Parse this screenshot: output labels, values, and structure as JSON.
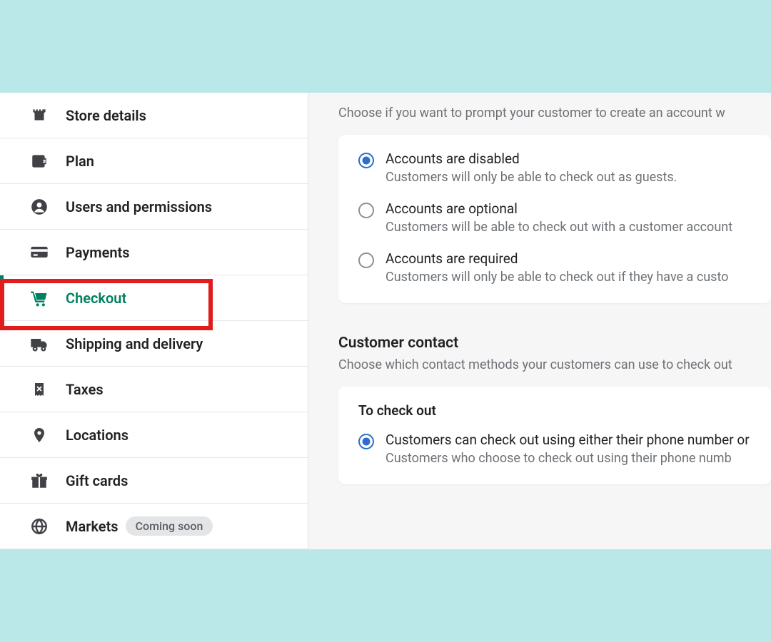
{
  "sidebar": {
    "items": [
      {
        "label": "Store details",
        "icon": "store"
      },
      {
        "label": "Plan",
        "icon": "wallet"
      },
      {
        "label": "Users and permissions",
        "icon": "user"
      },
      {
        "label": "Payments",
        "icon": "card"
      },
      {
        "label": "Checkout",
        "icon": "cart",
        "active": true,
        "highlighted": true
      },
      {
        "label": "Shipping and delivery",
        "icon": "truck"
      },
      {
        "label": "Taxes",
        "icon": "receipt"
      },
      {
        "label": "Locations",
        "icon": "pin"
      },
      {
        "label": "Gift cards",
        "icon": "gift"
      },
      {
        "label": "Markets",
        "icon": "globe",
        "badge": "Coming soon"
      }
    ]
  },
  "accounts_section": {
    "description": "Choose if you want to prompt your customer to create an account w",
    "options": [
      {
        "title": "Accounts are disabled",
        "subtitle": "Customers will only be able to check out as guests.",
        "selected": true
      },
      {
        "title": "Accounts are optional",
        "subtitle": "Customers will be able to check out with a customer account",
        "selected": false
      },
      {
        "title": "Accounts are required",
        "subtitle": "Customers will only be able to check out if they have a custo",
        "selected": false
      }
    ]
  },
  "contact_section": {
    "title": "Customer contact",
    "description": "Choose which contact methods your customers can use to check out",
    "group_heading": "To check out",
    "options": [
      {
        "title": "Customers can check out using either their phone number or",
        "subtitle": "Customers who choose to check out using their phone numb",
        "selected": true
      }
    ]
  }
}
